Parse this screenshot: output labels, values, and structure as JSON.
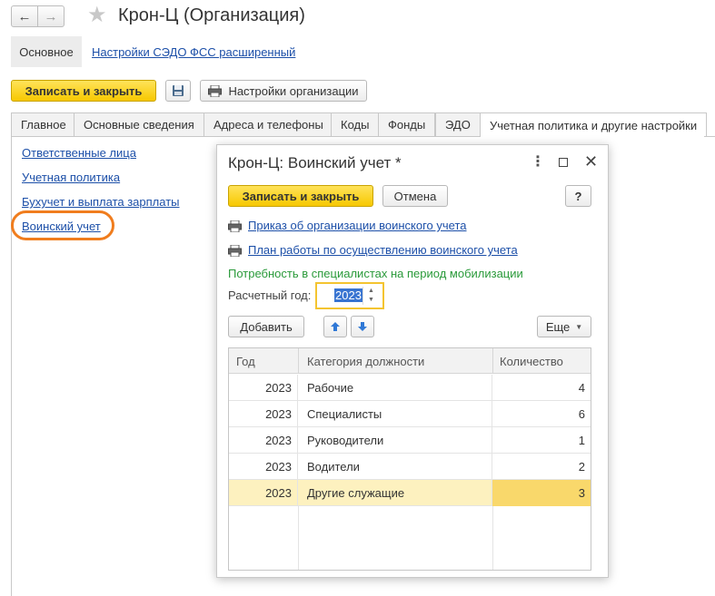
{
  "window": {
    "title": "Крон-Ц (Организация)",
    "nav_back": "←",
    "nav_forward": "→",
    "favorite_icon": "star-icon"
  },
  "top_panel": {
    "main_label": "Основное",
    "link": "Настройки СЭДО ФСС расширенный"
  },
  "toolbar": {
    "save_close": "Записать и закрыть",
    "org_settings": "Настройки организации"
  },
  "tabs": [
    {
      "label": "Главное"
    },
    {
      "label": "Основные сведения"
    },
    {
      "label": "Адреса и телефоны"
    },
    {
      "label": "Коды"
    },
    {
      "label": "Фонды"
    },
    {
      "label": "ЭДО"
    },
    {
      "label": "Учетная политика и другие настройки",
      "active": true
    }
  ],
  "side_links": [
    {
      "label": "Ответственные лица"
    },
    {
      "label": "Учетная политика"
    },
    {
      "label": "Бухучет и выплата зарплаты"
    },
    {
      "label": "Воинский учет",
      "highlighted": true
    }
  ],
  "dialog": {
    "title": "Крон-Ц: Воинский учет *",
    "save_close": "Записать и закрыть",
    "cancel": "Отмена",
    "help": "?",
    "print_link_1": "Приказ об организации воинского учета",
    "print_link_2": "План работы по осуществлению воинского учета",
    "section_title": "Потребность в специалистах на период мобилизации",
    "year_label": "Расчетный год:",
    "year_value": "2023",
    "add_button": "Добавить",
    "more_button": "Еще",
    "table": {
      "columns": [
        "Год",
        "Категория должности",
        "Количество"
      ],
      "rows": [
        {
          "year": "2023",
          "category": "Рабочие",
          "count": "4"
        },
        {
          "year": "2023",
          "category": "Специалисты",
          "count": "6"
        },
        {
          "year": "2023",
          "category": "Руководители",
          "count": "1"
        },
        {
          "year": "2023",
          "category": "Водители",
          "count": "2"
        },
        {
          "year": "2023",
          "category": "Другие служащие",
          "count": "3",
          "selected": true
        }
      ]
    }
  },
  "colors": {
    "accent_yellow": "#f7c800",
    "link_blue": "#1c4fa8",
    "green_text": "#2a9a3a",
    "highlight_orange": "#f07d1e",
    "selected_row": "#fdf1bf"
  }
}
